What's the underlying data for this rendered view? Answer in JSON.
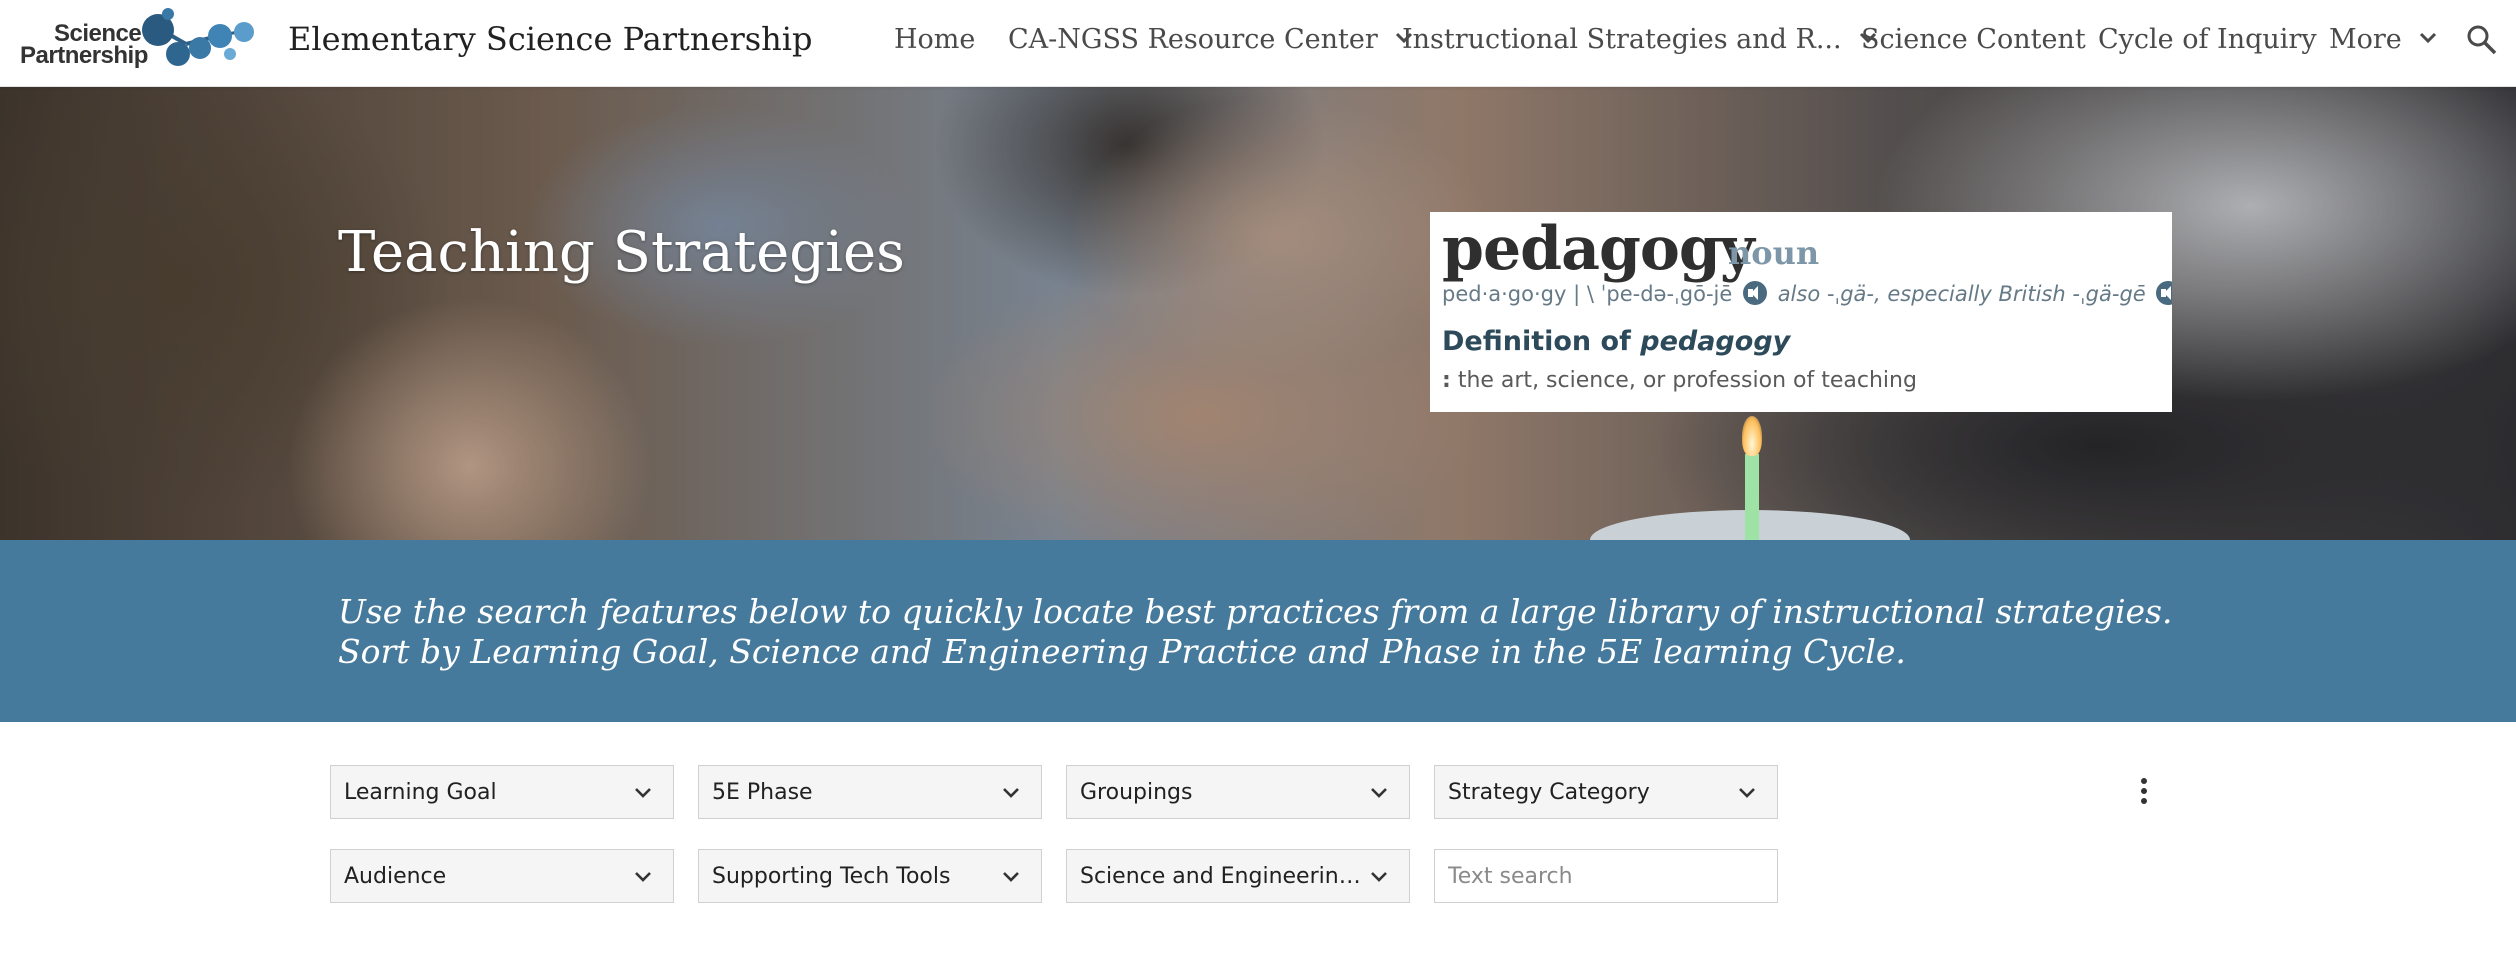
{
  "header": {
    "logo_text_line1": "Science",
    "logo_text_line2": "Partnership",
    "site_title": "Elementary Science Partnership",
    "nav": [
      {
        "label": "Home",
        "has_dropdown": false
      },
      {
        "label": "CA-NGSS Resource Center",
        "has_dropdown": true
      },
      {
        "label": "Instructional Strategies and R...",
        "has_dropdown": true
      },
      {
        "label": "Science Content",
        "has_dropdown": false
      },
      {
        "label": "Cycle of Inquiry",
        "has_dropdown": false
      },
      {
        "label": "More",
        "has_dropdown": true
      }
    ],
    "search_icon": "search-icon"
  },
  "hero": {
    "title": "Teaching Strategies",
    "dictionary": {
      "word": "pedagogy",
      "part_of_speech": "noun",
      "pronunciation": "ped·a·go·gy  |  \\ ˈpe-də-ˌgō-jē",
      "pronunciation_alt": "also -ˌgä-, especially British -ˌgä-gē",
      "pronunciation_tail": "\\",
      "definition_heading_prefix": "Definition of",
      "definition_heading_word": "pedagogy",
      "definition_marker": ":",
      "definition": "the art, science, or profession of teaching"
    }
  },
  "intro": {
    "text": "Use the search features below to quickly locate best practices from a large library of  instructional strategies.  Sort by Learning Goal, Science and Engineering Practice and Phase in the 5E learning Cycle."
  },
  "filters": {
    "row1": [
      "Learning Goal",
      "5E Phase",
      "Groupings",
      "Strategy Category"
    ],
    "row2": [
      "Audience",
      "Supporting Tech Tools",
      "Science and Engineering ..."
    ],
    "text_search_placeholder": "Text search"
  },
  "colors": {
    "band": "#467a9c",
    "nav_text": "#4a4a4a",
    "logo_blue": "#3a6f97",
    "dict_pos": "#7d97a8"
  }
}
